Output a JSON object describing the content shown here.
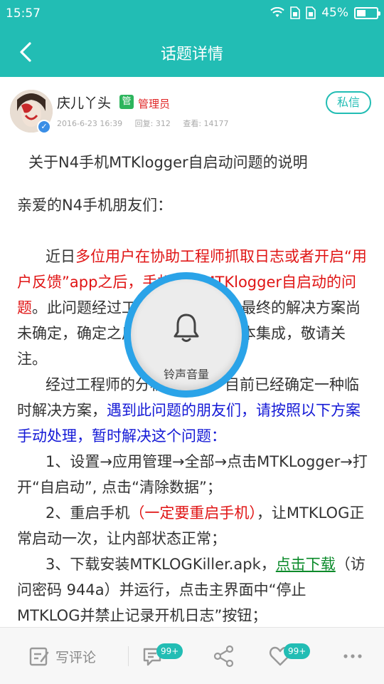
{
  "status_bar": {
    "time": "15:57",
    "battery": "45%",
    "battery_level": 0.45
  },
  "header": {
    "title": "话题详情"
  },
  "author": {
    "name": "庆儿丫头",
    "admin_badge": "管",
    "role": "管理员",
    "date": "2016-6-23 16:39",
    "replies": "回复: 312",
    "views": "查看: 14177",
    "pm_label": "私信"
  },
  "article": {
    "heading": "关于N4手机MTKlogger自启动问题的说明",
    "greeting": "亲爱的N4手机朋友们：",
    "p1_a": "近日",
    "p1_red": "多位用户在协助工程师抓取日志或者开启“用户反馈”app之后，手机出现MTKlogger自启动的问题",
    "p1_b": "。此问题经过工程师重点分析，最终的解决方案尚未确定，确定之后，会在后续的版本集成，敬请关注。",
    "p2_a": "经过工程师的分析和测试，目前已经确定一种临时解决方案，",
    "p2_blue": "遇到此问题的朋友们，请按照以下方案手动处理，暂时解决这个问题：",
    "step1": "1、设置→应用管理→全部→点击MTKLogger→打开“自启动”, 点击“清除数据”；",
    "step2_a": "2、重启手机",
    "step2_red": "（一定要重启手机）",
    "step2_b": "，让MTKLOG正常启动一次，让内部状态正常；",
    "step3_a": "3、下载安装MTKLOGKiller.apk，",
    "step3_link": "点击下载",
    "step3_b": "（访问密码 944a）并运行，点击主界面中“停止MTKLOG并禁止记录开机日志”按钮；"
  },
  "volume_overlay": {
    "label": "铃声音量"
  },
  "bottom_bar": {
    "comment_label": "写评论",
    "comments_badge": "99+",
    "likes_badge": "99+"
  },
  "colors": {
    "accent": "#22bdb4",
    "red_text": "#e01414",
    "blue_text": "#1419d6",
    "link_text": "#0a8a2a",
    "volume_ring": "#2aa3e8"
  }
}
